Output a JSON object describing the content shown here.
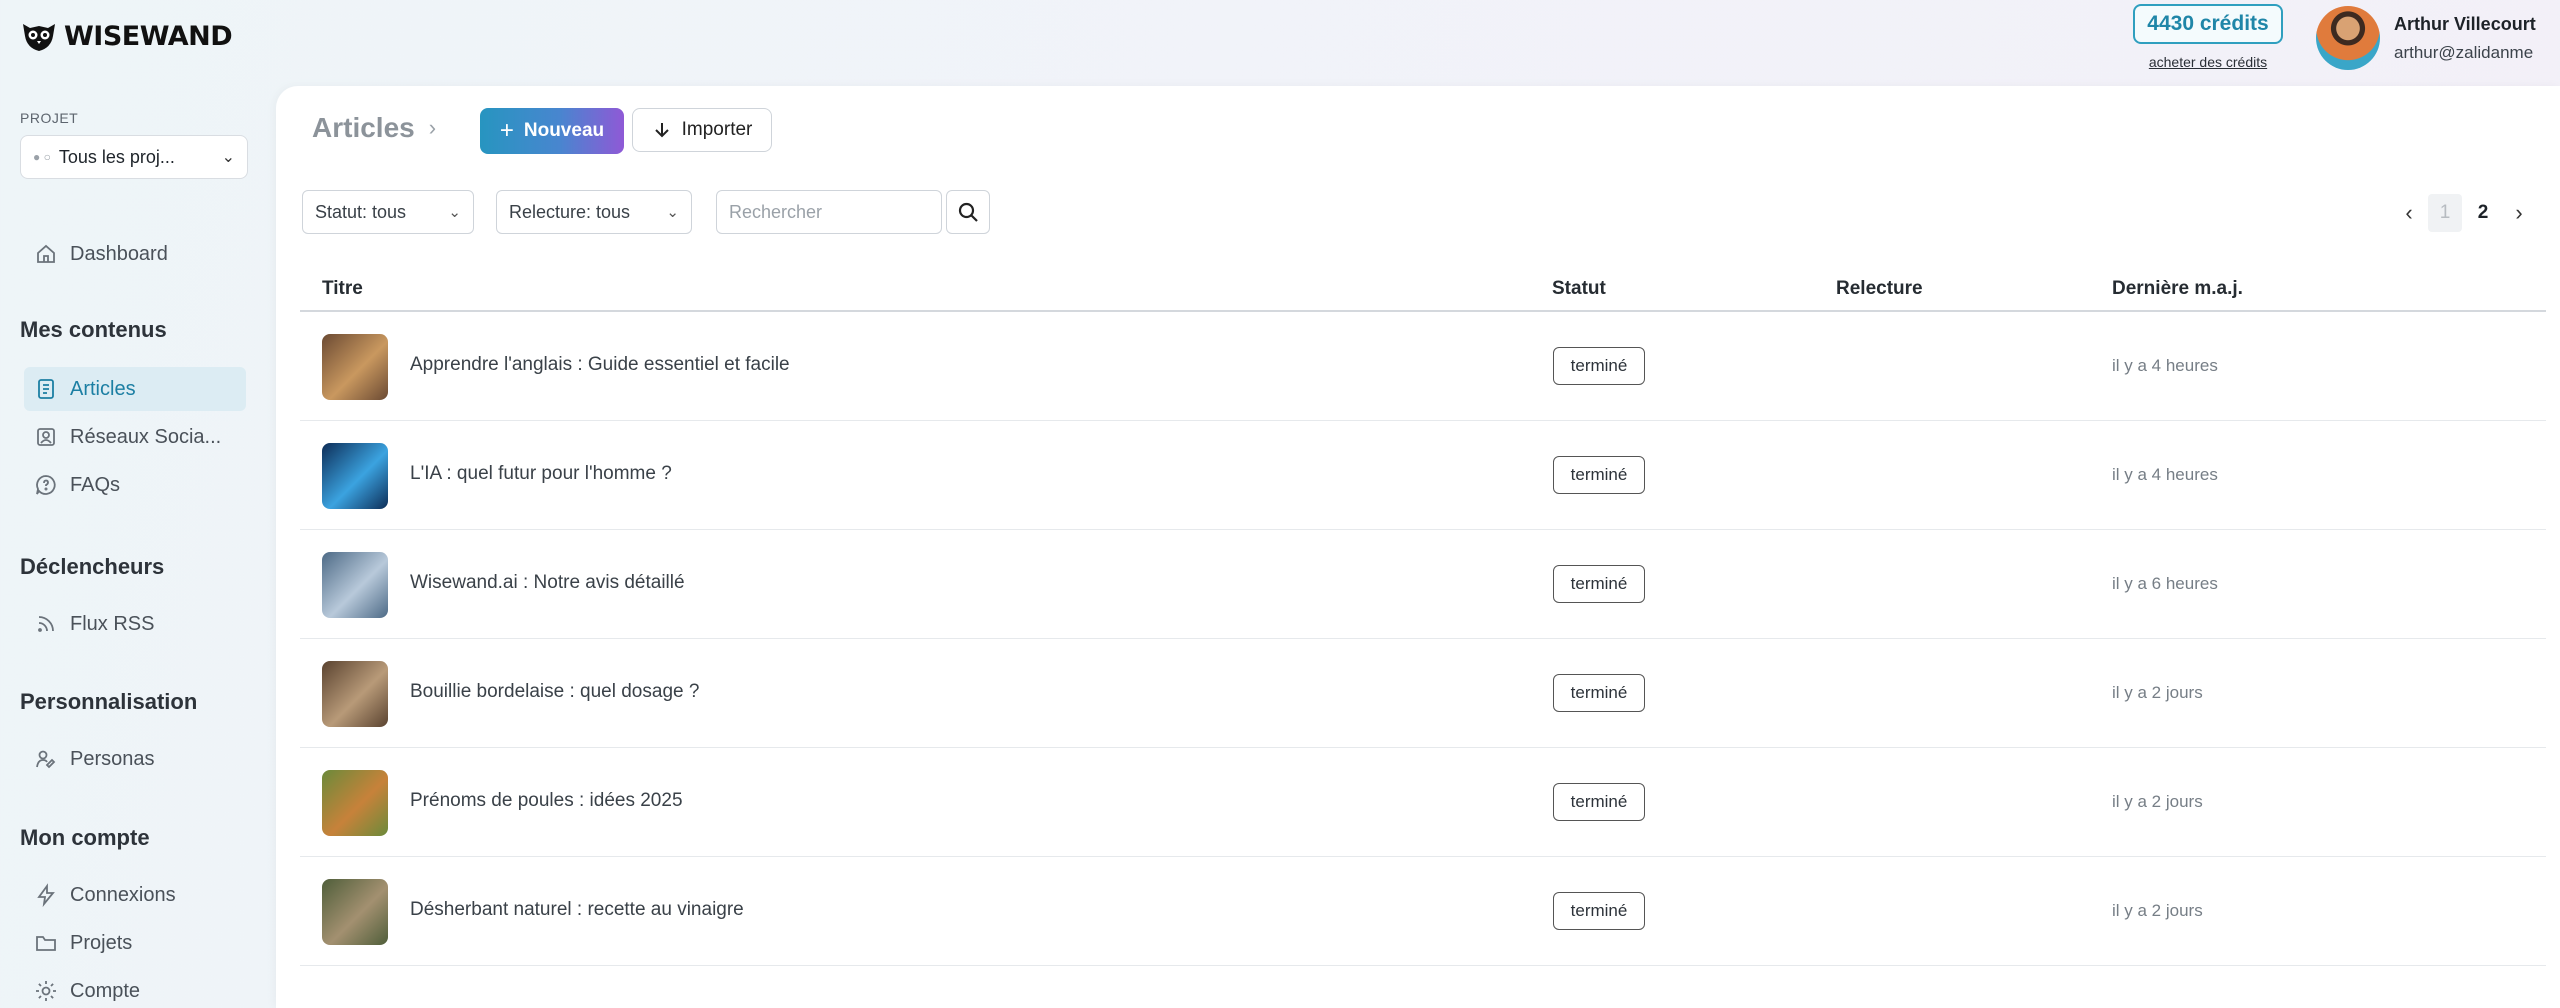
{
  "app": {
    "brand": "WISEWAND",
    "credits": "4430 crédits",
    "buy_credits": "acheter des crédits",
    "user_name": "Arthur Villecourt",
    "user_email": "arthur@zalidanme"
  },
  "sidebar": {
    "project_label": "PROJET",
    "project_value": "Tous les proj...",
    "dashboard": "Dashboard",
    "sections": {
      "contents": "Mes contenus",
      "triggers": "Déclencheurs",
      "personalization": "Personnalisation",
      "account": "Mon compte"
    },
    "items": {
      "articles": "Articles",
      "social": "Réseaux Socia...",
      "faqs": "FAQs",
      "rss": "Flux RSS",
      "personas": "Personas",
      "connections": "Connexions",
      "projects": "Projets",
      "account": "Compte"
    }
  },
  "main": {
    "breadcrumb": "Articles",
    "breadcrumb_sep": "›",
    "new_button": "Nouveau",
    "import_button": "Importer",
    "filters": {
      "status": "Statut: tous",
      "review": "Relecture: tous",
      "search_placeholder": "Rechercher"
    },
    "pagination": {
      "current": "1",
      "next": "2"
    },
    "columns": {
      "title": "Titre",
      "status": "Statut",
      "review": "Relecture",
      "updated": "Dernière m.a.j."
    },
    "rows": [
      {
        "title": "Apprendre l'anglais : Guide essentiel et facile",
        "status": "terminé",
        "updated": "il y a 4 heures",
        "thumb": [
          "#6b4a33",
          "#c9985f"
        ]
      },
      {
        "title": "L'IA : quel futur pour l'homme ?",
        "status": "terminé",
        "updated": "il y a 4 heures",
        "thumb": [
          "#0d2d57",
          "#3ba3e0"
        ]
      },
      {
        "title": "Wisewand.ai : Notre avis détaillé",
        "status": "terminé",
        "updated": "il y a 6 heures",
        "thumb": [
          "#4d6a86",
          "#b8c9da"
        ]
      },
      {
        "title": "Bouillie bordelaise : quel dosage ?",
        "status": "terminé",
        "updated": "il y a 2 jours",
        "thumb": [
          "#5a4330",
          "#b89a78"
        ]
      },
      {
        "title": "Prénoms de poules : idées 2025",
        "status": "terminé",
        "updated": "il y a 2 jours",
        "thumb": [
          "#6b8a3a",
          "#c7823a"
        ]
      },
      {
        "title": "Désherbant naturel : recette au vinaigre",
        "status": "terminé",
        "updated": "il y a 2 jours",
        "thumb": [
          "#4f5e3a",
          "#a39070"
        ]
      }
    ]
  }
}
